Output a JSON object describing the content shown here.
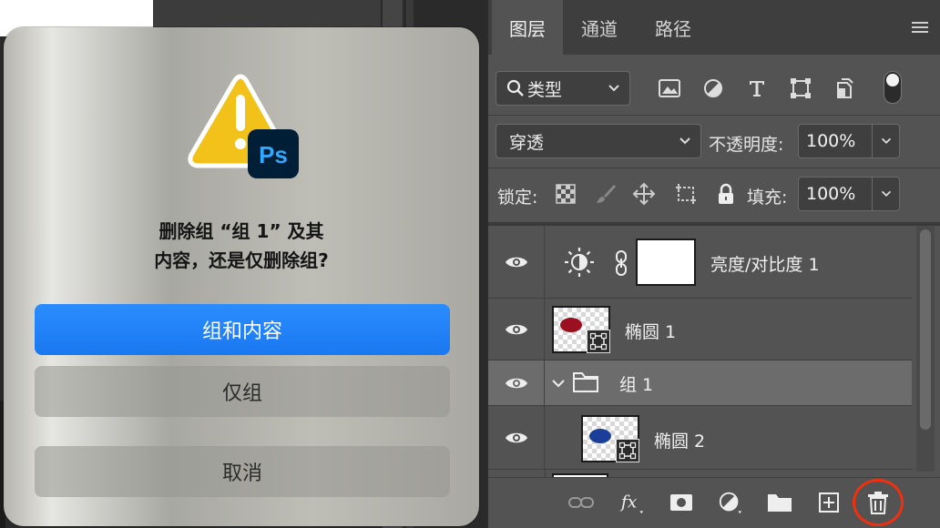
{
  "dialog": {
    "message_line1": "删除组 “组 1” 及其",
    "message_line2": "内容，还是仅删除组?",
    "btn_group_and_contents": "组和内容",
    "btn_group_only": "仅组",
    "btn_cancel": "取消",
    "icon_badge": "Ps"
  },
  "panel": {
    "tabs": [
      "图层",
      "通道",
      "路径"
    ],
    "filter_kind": "类型",
    "blend_mode": "穿透",
    "opacity_label": "不透明度:",
    "opacity_value": "100%",
    "lock_label": "锁定:",
    "fill_label": "填充:",
    "fill_value": "100%",
    "layers": [
      {
        "name": "亮度/对比度 1",
        "type": "adjustment"
      },
      {
        "name": "椭圆 1",
        "type": "shape",
        "color": "#9b1020"
      },
      {
        "name": "组 1",
        "type": "group",
        "expanded": true,
        "selected": true
      },
      {
        "name": "椭圆 2",
        "type": "shape",
        "color": "#1b3f99",
        "indented": true
      }
    ]
  },
  "colors": {
    "accent": "#1a78f0",
    "highlight_ring": "#f0300e",
    "warning_yellow": "#f2c21a",
    "ps_badge": "#001e36",
    "ps_text": "#31a8ff"
  }
}
